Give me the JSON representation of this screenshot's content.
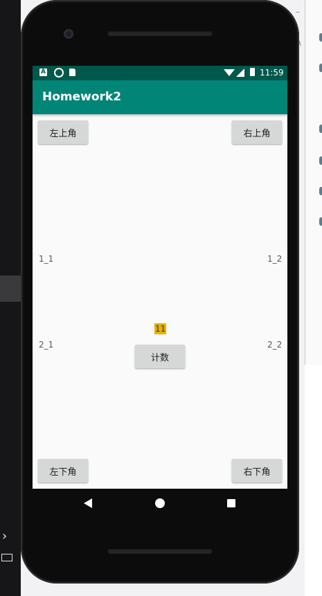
{
  "app": {
    "title": "Homework2",
    "status_time": "11:59"
  },
  "buttons": {
    "top_left": "左上角",
    "top_right": "右上角",
    "bottom_left": "左下角",
    "bottom_right": "右下角",
    "count": "计数"
  },
  "labels": {
    "r1_left": "1_1",
    "r1_right": "1_2",
    "r2_left": "2_1",
    "r2_right": "2_2"
  },
  "counter_value": "11",
  "colors": {
    "primary": "#008577",
    "primary_dark": "#00574b",
    "counter_bg": "#e8b100",
    "button_bg": "#d6d7d7"
  },
  "icons": {
    "status": [
      "android-icon",
      "circle-icon",
      "sdcard-icon",
      "wifi-icon",
      "signal-icon",
      "battery-icon"
    ],
    "nav": [
      "back-icon",
      "home-icon",
      "recents-icon"
    ]
  }
}
